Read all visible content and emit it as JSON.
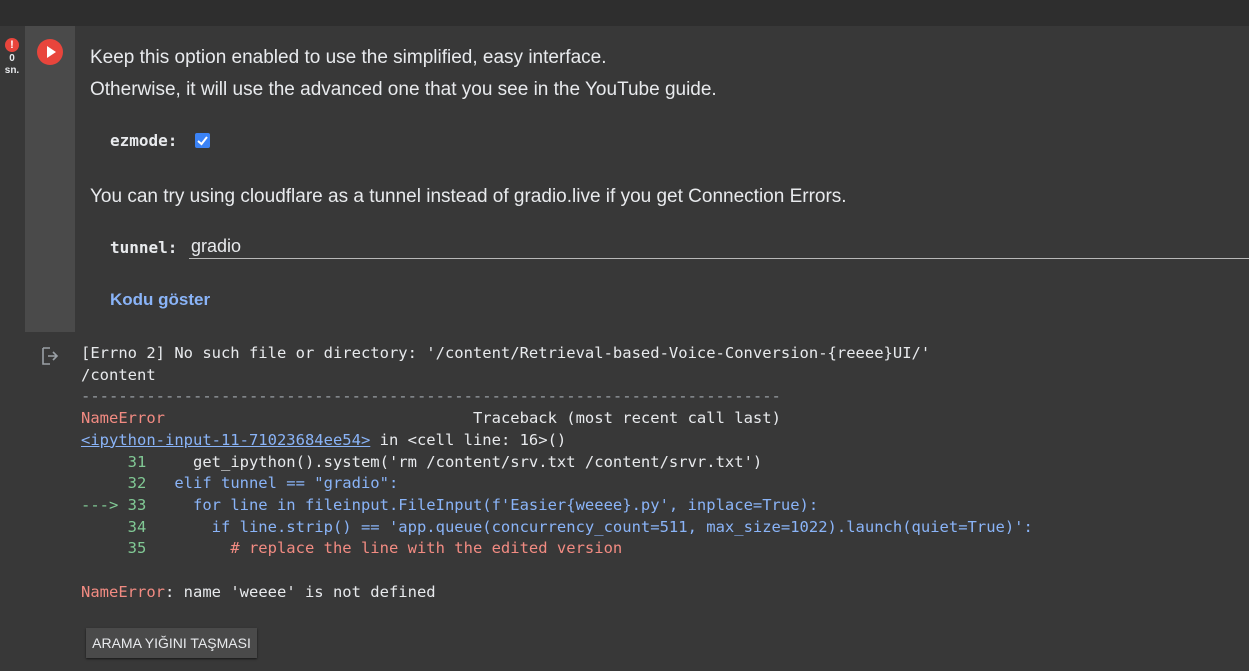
{
  "status": {
    "count": "0",
    "unit": "sn."
  },
  "cell": {
    "line1": "Keep this option enabled to use the simplified, easy interface.",
    "line2": "Otherwise, it will use the advanced one that you see in the YouTube guide.",
    "ezmode_label": "ezmode:",
    "ezmode_checked": true,
    "line3": "You can try using cloudflare as a tunnel instead of gradio.live if you get Connection Errors.",
    "tunnel_label": "tunnel:",
    "tunnel_value": "gradio",
    "show_code": "Kodu göster"
  },
  "output": {
    "line1": "[Errno 2] No such file or directory: '/content/Retrieval-based-Voice-Conversion-{reeee}UI/'",
    "line2": "/content",
    "separator": "---------------------------------------------------------------------------",
    "error_name": "NameError",
    "traceback_header": "Traceback (most recent call last)",
    "location_link": "<ipython-input-11-71023684ee54>",
    "location_rest": " in <cell line: 16>()",
    "code_lines": [
      {
        "prefix": "     31",
        "code": "     get_ipython().system('rm /content/srv.txt /content/srvr.txt')"
      },
      {
        "prefix": "     32",
        "code": "   elif tunnel == \"gradio\":"
      },
      {
        "prefix": "---> 33",
        "code": "     for line in fileinput.FileInput(f'Easier{weeee}.py', inplace=True):"
      },
      {
        "prefix": "     34",
        "code": "       if line.strip() == 'app.queue(concurrency_count=511, max_size=1022).launch(quiet=True)':"
      },
      {
        "prefix": "     35",
        "code": "         # replace the line with the edited version"
      }
    ],
    "final_error_name": "NameError",
    "final_error_msg": ": name 'weeee' is not defined"
  },
  "stack_button": "ARAMA YIĞINI TAŞMASI",
  "colors": {
    "run_button": "#e8453c",
    "checkbox": "#3b83f6",
    "link": "#8ab4f8",
    "error": "#f28b82",
    "line_number": "#81c995"
  }
}
